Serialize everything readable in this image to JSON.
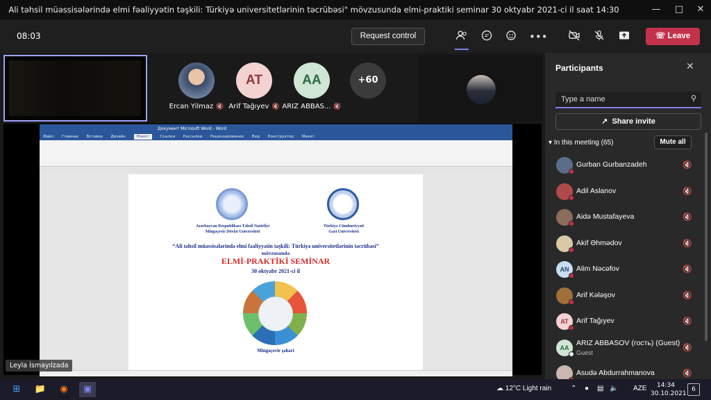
{
  "window": {
    "title": "Ali təhsil müəssisələrində elmi fəaliyyətin təşkili: Türkiyə universitetlərinin təcrübəsi\" mövzusunda elmi-praktiki seminar 30 oktyabr 2021-ci il saat 14:30"
  },
  "toolbar": {
    "timer": "08:03",
    "request_control": "Request control",
    "leave": "Leave"
  },
  "stage": {
    "participants": [
      {
        "name": "Ercan Yilmaz",
        "initials": "",
        "color": "#6e7d90"
      },
      {
        "name": "Arif Tağıyev",
        "initials": "AT",
        "color": "#f4d2d2"
      },
      {
        "name": "ARIZ ABBAS...",
        "initials": "AA",
        "color": "#cfe6d5"
      }
    ],
    "more_count": "+60",
    "caption": "Leyla İsmayılzada"
  },
  "shared_doc": {
    "window_title": "Документ Microsoft Word - Word",
    "tabs": [
      "Файл",
      "Главная",
      "Вставка",
      "Дизайн",
      "Макет",
      "Ссылки",
      "Рассылки",
      "Рецензирование",
      "Вид",
      "Конструктор",
      "Макет"
    ],
    "selected_tab": "Макет",
    "org_left_1": "Azərbaycan Respublikası Təhsil Nazirliyi",
    "org_left_2": "Mingəçevir Dövlət Universiteti",
    "org_right_1": "Türkiyə Cümhuriyyəti",
    "org_right_2": "Gazi Universiteti",
    "topic": "“Ali təhsil müəssisələrində elmi fəaliyyətin təşkili: Türkiyə universitetlərinin təcrübəsi”",
    "topic_sub": "mövzusunda",
    "heading": "ELMİ-PRAKTİKİ SEMİNAR",
    "date": "30 oktyabr 2021-ci il",
    "city": "Mingəçevir şəhəri"
  },
  "panel": {
    "title": "Participants",
    "search_placeholder": "Type a name",
    "share_invite": "Share invite",
    "in_meeting": "In this meeting (65)",
    "mute_all": "Mute all",
    "list": [
      {
        "name": "Gurban Gurbanzadeh",
        "initials": "",
        "color": "#5a6e8c",
        "sub": ""
      },
      {
        "name": "Adil Aslanov",
        "initials": "",
        "color": "#b04a4a",
        "sub": ""
      },
      {
        "name": "Aidə Mustafayeva",
        "initials": "",
        "color": "#8a6d5a",
        "sub": ""
      },
      {
        "name": "Akif Əhmədov",
        "initials": "",
        "color": "#d9c9a8",
        "sub": ""
      },
      {
        "name": "Alim Nəcəfov",
        "initials": "AN",
        "color": "#c7ddf0",
        "sub": ""
      },
      {
        "name": "Arif Kələşov",
        "initials": "",
        "color": "#a0703a",
        "sub": ""
      },
      {
        "name": "Arif Tağıyev",
        "initials": "AT",
        "color": "#f4d2d2",
        "sub": ""
      },
      {
        "name": "ARIZ ABBASOV (гость) (Guest)",
        "initials": "AA",
        "color": "#cfe6d5",
        "sub": "Guest"
      },
      {
        "name": "Asudə Abdurrahmanova",
        "initials": "",
        "color": "#c9b8b0",
        "sub": ""
      }
    ]
  },
  "taskbar": {
    "weather": "12°C  Light rain",
    "lang": "AZE",
    "time": "14:34",
    "date": "30.10.2021",
    "notifications": "6"
  }
}
